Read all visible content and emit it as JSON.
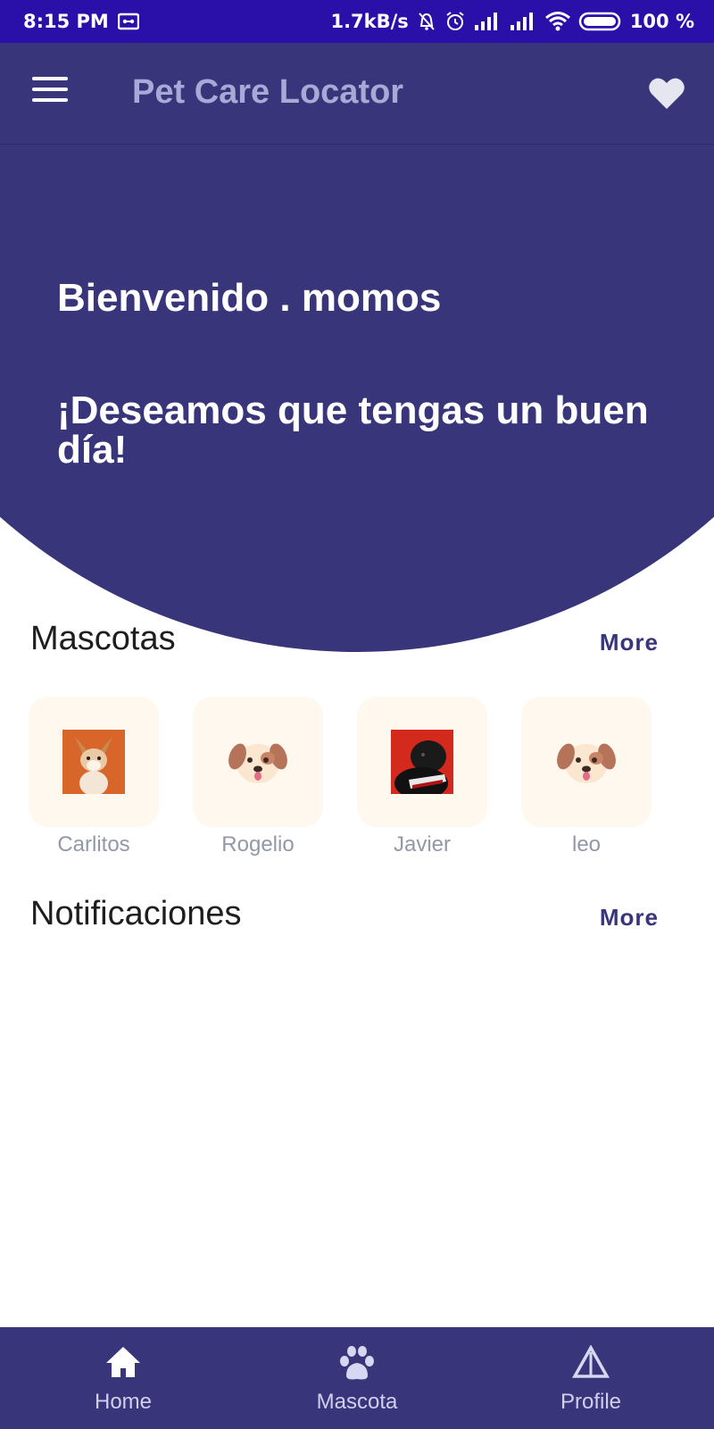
{
  "status_bar": {
    "time": "8:15 PM",
    "network_speed": "1.7kB/s",
    "battery": "100 %"
  },
  "app_bar": {
    "title": "Pet Care Locator",
    "menu_icon": "hamburger-menu-icon",
    "favorite_icon": "heart-icon"
  },
  "hero": {
    "welcome": "Bienvenido . momos",
    "wish": "¡Deseamos que tengas un buen día!"
  },
  "pets_section": {
    "title": "Mascotas",
    "more_label": "More",
    "items": [
      {
        "name": "Carlitos",
        "image": "corgi-photo"
      },
      {
        "name": "Rogelio",
        "image": "dog-face-icon"
      },
      {
        "name": "Javier",
        "image": "pug-photo"
      },
      {
        "name": "leo",
        "image": "dog-face-icon"
      }
    ]
  },
  "notifications_section": {
    "title": "Notificaciones",
    "more_label": "More"
  },
  "bottom_nav": {
    "items": [
      {
        "label": "Home",
        "icon": "home-icon"
      },
      {
        "label": "Mascota",
        "icon": "paw-icon"
      },
      {
        "label": "Profile",
        "icon": "triangle-warning-icon"
      }
    ]
  },
  "colors": {
    "status_bar": "#2a0fa8",
    "primary": "#38357a",
    "title_text": "#a7aad6",
    "pet_card": "#fff8ee"
  }
}
